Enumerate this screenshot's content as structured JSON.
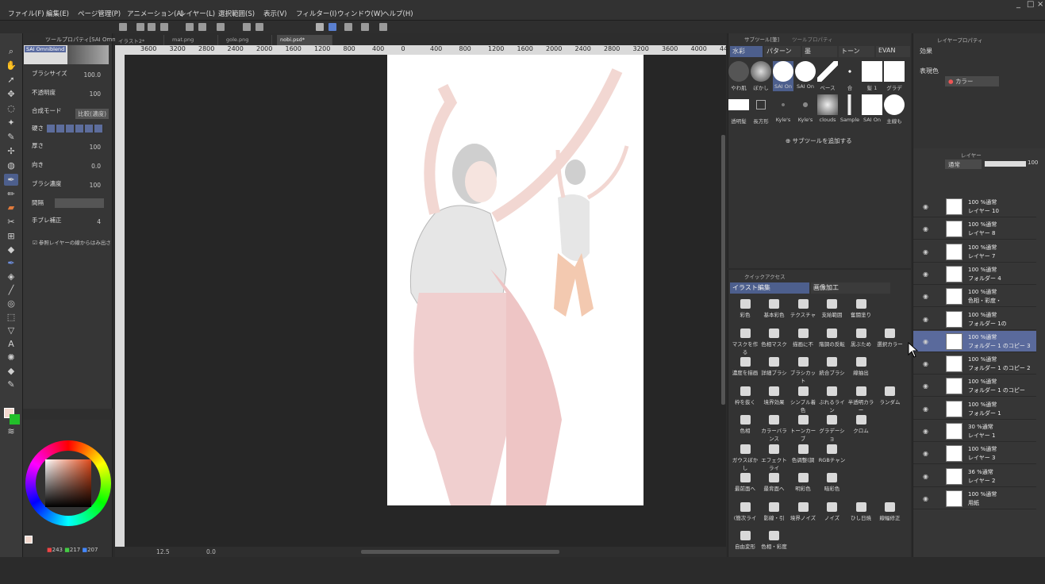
{
  "menu": {
    "items": [
      "ファイル(F)",
      "編集(E)",
      "ページ管理(P)",
      "アニメーション(A)",
      "レイヤー(L)",
      "選択範囲(S)",
      "表示(V)",
      "フィルター(I)",
      "ウィンドウ(W)",
      "ヘルプ(H)"
    ],
    "window_controls": [
      "_",
      "□",
      "×"
    ]
  },
  "tool_property": {
    "title": "ツールプロパティ[SAI Omniblend]",
    "preset_name": "SAI Omniblend",
    "rows": [
      {
        "label": "ブラシサイズ",
        "value": "100.0"
      },
      {
        "label": "不透明度",
        "value": "100"
      },
      {
        "label": "合成モード",
        "value": "比較(濃度)"
      },
      {
        "label": "硬さ",
        "value": ""
      },
      {
        "label": "厚さ",
        "value": "100"
      },
      {
        "label": "向き",
        "value": "0.0"
      },
      {
        "label": "ブラシ濃度",
        "value": "100"
      },
      {
        "label": "間隔",
        "value": ""
      },
      {
        "label": "手ブレ補正",
        "value": "4"
      }
    ],
    "checkbox_label": "参照レイヤーの線からはみ出さ"
  },
  "color": {
    "r": "243",
    "g": "217",
    "b": "207",
    "main_color": "#f3d9cf",
    "sub_color": "#22c02a"
  },
  "tabs": [
    {
      "label": "イラスト2*"
    },
    {
      "label": "mat.png"
    },
    {
      "label": "gole.png"
    },
    {
      "label": "nobi.psd*"
    }
  ],
  "ruler": [
    "3600",
    "3200",
    "2800",
    "2400",
    "2000",
    "1600",
    "1200",
    "800",
    "400",
    "0",
    "400",
    "800",
    "1200",
    "1600",
    "2000",
    "2400",
    "2800",
    "3200",
    "3600",
    "4000",
    "4400"
  ],
  "canvas_status": {
    "zoom": "12.5",
    "angle": "0.0"
  },
  "subtool": {
    "header_tabs": [
      "サブツール[筆]",
      "ツールプロパティ"
    ],
    "tabs": [
      "水彩",
      "パターン",
      "墨",
      "トーン",
      "EVAN"
    ],
    "brushes_row1": [
      "やわ肌",
      "ぼかし",
      "SAI On",
      "SAI On",
      "ベース",
      "",
      "合",
      "髪 1",
      "グラデ"
    ],
    "brushes_row2": [
      "透明髪",
      "長方形",
      "Kyle's",
      "Kyle's",
      "clouds",
      "Sample",
      "SAI On",
      "主線も"
    ],
    "add_label": "サブツールを追加する"
  },
  "quick_access": {
    "header": "クイックアクセス",
    "tabs": [
      "イラスト編集",
      "画像加工"
    ],
    "rows": [
      [
        "彩色",
        "基本彩色",
        "テクスチャ",
        "支給範囲",
        "奮闘塗り"
      ],
      [
        "マスクを作る",
        "色相マスク",
        "描画に不",
        "階調の反転",
        "黒ぶため",
        "選択カラー"
      ],
      [
        "濃度を描画",
        "詳細ブラシ",
        "ブラシカット",
        "統合ブラシ",
        "線抽出"
      ],
      [
        "枠を抜く",
        "境界効果",
        "シンプル着色",
        "ぶれるライン",
        "半透明カラー",
        "ランダム"
      ],
      [
        "色相",
        "カラーバランス",
        "トーンカーブ",
        "グラデーショ",
        "クロム"
      ],
      [
        "ガウスぼかし",
        "エフェクトライ",
        "色调整(調",
        "RGBチャン"
      ],
      [
        "最前面へ",
        "最背面へ",
        "明彩色",
        "暗彩色"
      ],
      [
        "(簡次ライ",
        "影線・引",
        "境界ノイズ",
        "ノイズ",
        "ひし日焼",
        "線幅修正"
      ],
      [
        "自由変形",
        "色相・彩度"
      ]
    ]
  },
  "layer_property": {
    "title": "レイヤープロパティ",
    "effect_label": "効果",
    "expression_label": "表現色",
    "expression_value": "カラー"
  },
  "layers": {
    "title": "レイヤー",
    "blend_mode": "通常",
    "opacity": "100",
    "items": [
      {
        "op": "100 %通常",
        "name": "レイヤー 10"
      },
      {
        "op": "100 %通常",
        "name": "レイヤー 8"
      },
      {
        "op": "100 %通常",
        "name": "レイヤー 7"
      },
      {
        "op": "100 %通常",
        "name": "フォルダー 4"
      },
      {
        "op": "100 %通常",
        "name": "色相・彩度・"
      },
      {
        "op": "100 %通常",
        "name": "フォルダー 1の"
      },
      {
        "op": "100 %通常",
        "name": "フォルダー 1 のコピー 3"
      },
      {
        "op": "100 %通常",
        "name": "フォルダー 1 のコピー 2"
      },
      {
        "op": "100 %通常",
        "name": "フォルダー 1 のコピー"
      },
      {
        "op": "100 %通常",
        "name": "フォルダー 1"
      },
      {
        "op": "30 %通常",
        "name": "レイヤー 1"
      },
      {
        "op": "100 %通常",
        "name": "レイヤー 3"
      },
      {
        "op": "36 %通常",
        "name": "レイヤー 2"
      },
      {
        "op": "100 %通常",
        "name": "用紙"
      }
    ]
  }
}
